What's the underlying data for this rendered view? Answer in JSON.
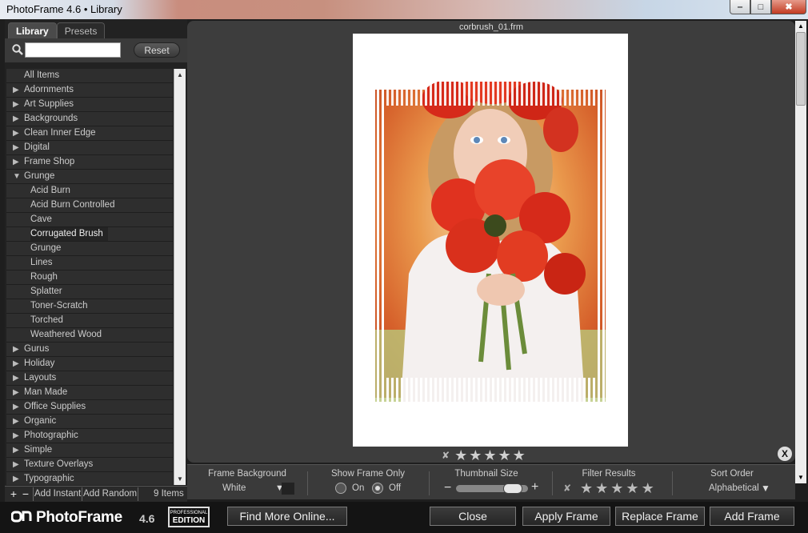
{
  "window": {
    "title": "PhotoFrame 4.6 • Library",
    "minimize_icon": "‒",
    "maximize_icon": "□",
    "close_icon": "✖"
  },
  "sidebar": {
    "tabs": [
      {
        "label": "Library",
        "active": true
      },
      {
        "label": "Presets",
        "active": false
      }
    ],
    "search_value": "",
    "reset_label": "Reset",
    "items": [
      {
        "label": "All Items",
        "level": 0,
        "expandable": false,
        "expanded": false
      },
      {
        "label": "Adornments",
        "level": 0,
        "expandable": true,
        "expanded": false
      },
      {
        "label": "Art Supplies",
        "level": 0,
        "expandable": true,
        "expanded": false
      },
      {
        "label": "Backgrounds",
        "level": 0,
        "expandable": true,
        "expanded": false
      },
      {
        "label": "Clean Inner Edge",
        "level": 0,
        "expandable": true,
        "expanded": false
      },
      {
        "label": "Digital",
        "level": 0,
        "expandable": true,
        "expanded": false
      },
      {
        "label": "Frame Shop",
        "level": 0,
        "expandable": true,
        "expanded": false
      },
      {
        "label": "Grunge",
        "level": 0,
        "expandable": true,
        "expanded": true
      },
      {
        "label": "Acid Burn",
        "level": 1,
        "expandable": false,
        "expanded": false
      },
      {
        "label": "Acid Burn Controlled",
        "level": 1,
        "expandable": false,
        "expanded": false
      },
      {
        "label": "Cave",
        "level": 1,
        "expandable": false,
        "expanded": false
      },
      {
        "label": "Corrugated Brush",
        "level": 1,
        "expandable": false,
        "expanded": false,
        "selected": true
      },
      {
        "label": "Grunge",
        "level": 1,
        "expandable": false,
        "expanded": false
      },
      {
        "label": "Lines",
        "level": 1,
        "expandable": false,
        "expanded": false
      },
      {
        "label": "Rough",
        "level": 1,
        "expandable": false,
        "expanded": false
      },
      {
        "label": "Splatter",
        "level": 1,
        "expandable": false,
        "expanded": false
      },
      {
        "label": "Toner-Scratch",
        "level": 1,
        "expandable": false,
        "expanded": false
      },
      {
        "label": "Torched",
        "level": 1,
        "expandable": false,
        "expanded": false
      },
      {
        "label": "Weathered Wood",
        "level": 1,
        "expandable": false,
        "expanded": false
      },
      {
        "label": "Gurus",
        "level": 0,
        "expandable": true,
        "expanded": false
      },
      {
        "label": "Holiday",
        "level": 0,
        "expandable": true,
        "expanded": false
      },
      {
        "label": "Layouts",
        "level": 0,
        "expandable": true,
        "expanded": false
      },
      {
        "label": "Man Made",
        "level": 0,
        "expandable": true,
        "expanded": false
      },
      {
        "label": "Office Supplies",
        "level": 0,
        "expandable": true,
        "expanded": false
      },
      {
        "label": "Organic",
        "level": 0,
        "expandable": true,
        "expanded": false
      },
      {
        "label": "Photographic",
        "level": 0,
        "expandable": true,
        "expanded": false
      },
      {
        "label": "Simple",
        "level": 0,
        "expandable": true,
        "expanded": false
      },
      {
        "label": "Texture Overlays",
        "level": 0,
        "expandable": true,
        "expanded": false
      },
      {
        "label": "Typographic",
        "level": 0,
        "expandable": true,
        "expanded": false
      }
    ],
    "bottom": {
      "add_symbol": "+",
      "remove_symbol": "−",
      "add_instant": "Add Instant",
      "add_random": "Add Random",
      "count": "9 Items"
    }
  },
  "preview": {
    "filename": "corbrush_01.frm",
    "rating_clear_icon": "✘",
    "star_symbol": "★",
    "stars": 5,
    "close_symbol": "X"
  },
  "options": {
    "frame_background": {
      "label": "Frame Background",
      "value": "White",
      "arrow": "▼"
    },
    "show_frame_only": {
      "label": "Show Frame Only",
      "on_label": "On",
      "off_label": "Off",
      "selected": "Off"
    },
    "thumbnail_size": {
      "label": "Thumbnail Size",
      "minus": "−",
      "plus": "+",
      "value_fraction": 0.9
    },
    "filter_results": {
      "label": "Filter Results",
      "clear_icon": "✘",
      "star_symbol": "★",
      "stars": 5
    },
    "sort_order": {
      "label": "Sort Order",
      "value": "Alphabetical",
      "arrow": "▼"
    }
  },
  "toolbar": {
    "brand_name": "PhotoFrame",
    "brand_version": "4.6",
    "badge_top": "PROFESSIONAL",
    "badge_bottom": "EDITION",
    "find_more": "Find More Online...",
    "close": "Close",
    "apply": "Apply Frame",
    "replace": "Replace Frame",
    "add": "Add Frame"
  },
  "colors": {
    "accent_red": "#d62a1a",
    "panel_dark": "#3d3d3d"
  }
}
